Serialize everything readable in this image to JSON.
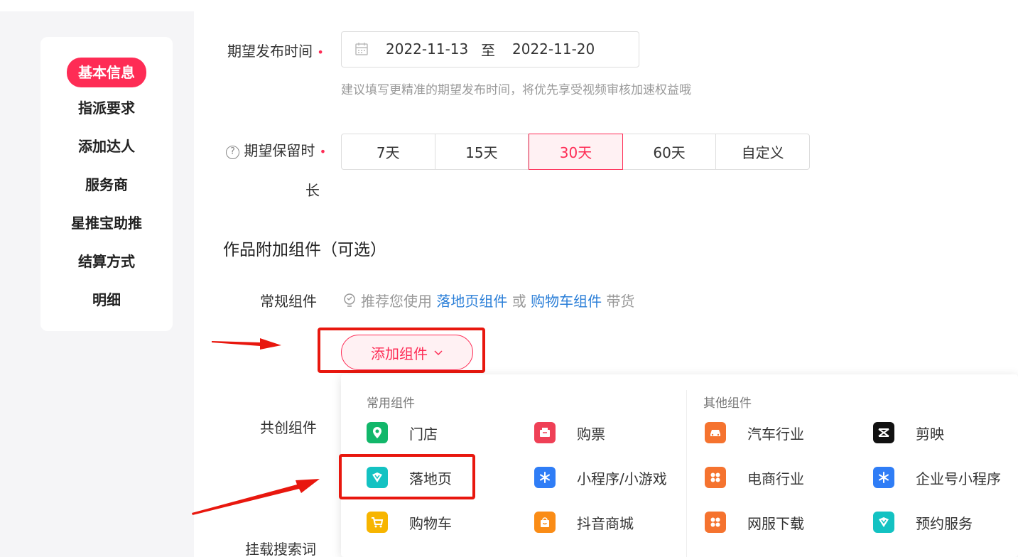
{
  "sidebar": {
    "items": [
      {
        "label": "基本信息",
        "active": true
      },
      {
        "label": "指派要求"
      },
      {
        "label": "添加达人"
      },
      {
        "label": "服务商"
      },
      {
        "label": "星推宝助推"
      },
      {
        "label": "结算方式"
      },
      {
        "label": "明细"
      }
    ]
  },
  "publish_time": {
    "label": "期望发布时间",
    "start": "2022-11-13",
    "to": "至",
    "end": "2022-11-20",
    "hint": "建议填写更精准的期望发布时间，将优先享受视频审核加速权益哦"
  },
  "retention": {
    "label_line1": "期望保留时",
    "label_line2": "长",
    "options": [
      "7天",
      "15天",
      "30天",
      "60天",
      "自定义"
    ],
    "selected": "30天"
  },
  "components": {
    "section_title": "作品附加组件（可选）",
    "regular_label": "常规组件",
    "tip_prefix": "推荐您使用",
    "tip_link1": "落地页组件",
    "tip_or": "或",
    "tip_link2": "购物车组件",
    "tip_suffix": "带货",
    "add_button": "添加组件",
    "cocreate_label": "共创组件",
    "search_label": "挂载搜索词"
  },
  "dropdown": {
    "common_title": "常用组件",
    "other_title": "其他组件",
    "common_items": [
      {
        "label": "门店",
        "icon": "location-icon",
        "color": "#12b76a"
      },
      {
        "label": "购票",
        "icon": "ticket-icon",
        "color": "#ef4056"
      },
      {
        "label": "落地页",
        "icon": "landing-page-icon",
        "color": "#13c2c2"
      },
      {
        "label": "小程序/小游戏",
        "icon": "mini-program-icon",
        "color": "#2f7df6"
      },
      {
        "label": "购物车",
        "icon": "cart-icon",
        "color": "#f7b500"
      },
      {
        "label": "抖音商城",
        "icon": "shopping-bag-icon",
        "color": "#fa8c16"
      }
    ],
    "other_items": [
      {
        "label": "汽车行业",
        "icon": "car-icon",
        "color": "#f5732f"
      },
      {
        "label": "剪映",
        "icon": "capcut-icon",
        "color": "#111111"
      },
      {
        "label": "电商行业",
        "icon": "grid-icon",
        "color": "#f5732f"
      },
      {
        "label": "企业号小程序",
        "icon": "mini-program-icon",
        "color": "#2f7df6"
      },
      {
        "label": "网服下载",
        "icon": "grid-icon",
        "color": "#f5732f"
      },
      {
        "label": "预约服务",
        "icon": "landing-page-icon",
        "color": "#13c2c2"
      }
    ]
  }
}
